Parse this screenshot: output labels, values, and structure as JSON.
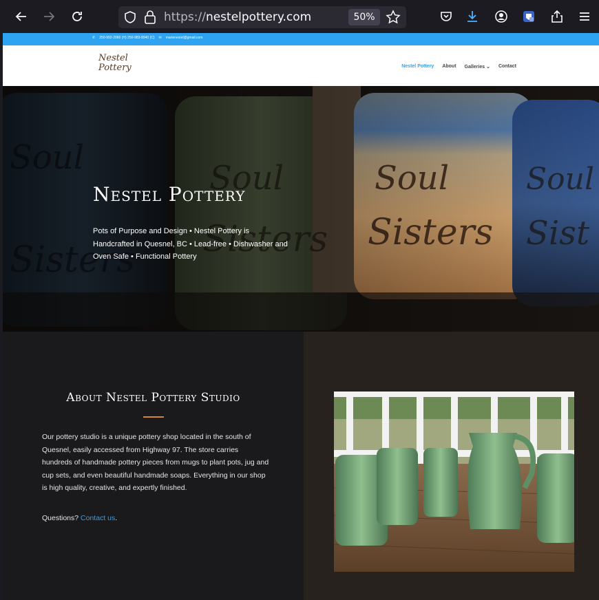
{
  "browser": {
    "url_scheme": "https://",
    "url_host": "nestelpottery.com",
    "zoom": "50%"
  },
  "topbar": {
    "phone": "250-992-2060 (H) 250-983-8940 (C)",
    "email": "marienestel@gmail.com"
  },
  "header": {
    "logo_line1": "Nestel",
    "logo_line2": "Pottery",
    "menu": [
      "Nestel Pottery",
      "About",
      "Galleries",
      "Contact"
    ]
  },
  "hero": {
    "title": "Nestel Pottery",
    "subtitle": "Pots of Purpose and Design • Nestel Pottery is Handcrafted in Quesnel, BC • Lead-free • Dishwasher and Oven Safe • Functional Pottery"
  },
  "about": {
    "title": "About Nestel Pottery Studio",
    "body": "Our pottery studio is a unique pottery shop located in the south of Quesnel, easily accessed from Highway 97. The store carries hundreds of handmade pottery pieces from mugs to plant pots, jug and cup sets, and even beautiful handmade soaps. Everything in our shop is high quality, creative, and expertly finished.",
    "question_prefix": "Questions?",
    "contact_link": "Contact us",
    "question_suffix": "."
  },
  "colors": {
    "accent": "#2ea3f2",
    "divider": "#d4883a",
    "chrome_bg": "#1c1b22"
  }
}
